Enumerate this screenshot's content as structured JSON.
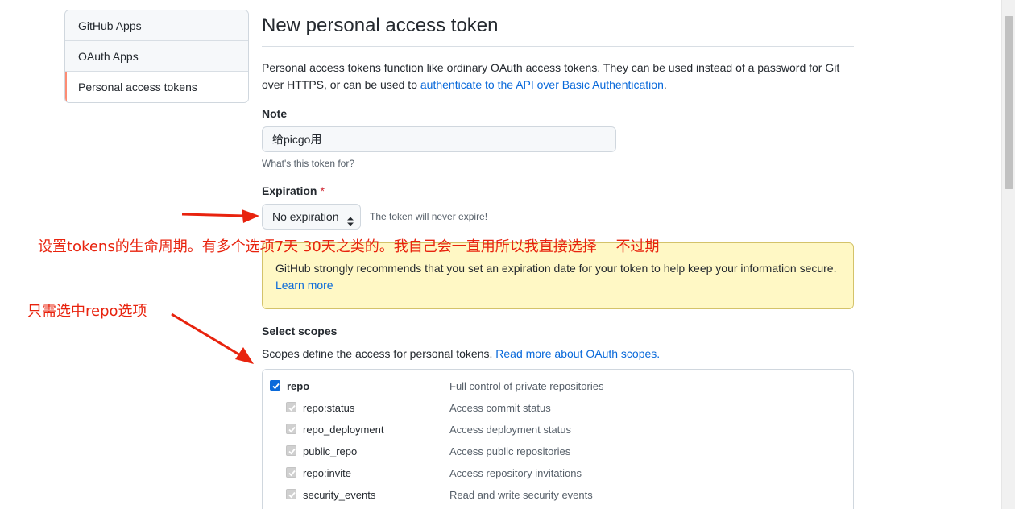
{
  "sidebar": {
    "items": [
      {
        "label": "GitHub Apps"
      },
      {
        "label": "OAuth Apps"
      },
      {
        "label": "Personal access tokens"
      }
    ]
  },
  "page": {
    "title": "New personal access token",
    "intro_text": "Personal access tokens function like ordinary OAuth access tokens. They can be used instead of a password for Git over HTTPS, or can be used to ",
    "intro_link": "authenticate to the API over Basic Authentication",
    "intro_end": "."
  },
  "note": {
    "label": "Note",
    "value": "给picgo用",
    "hint": "What's this token for?"
  },
  "expiration": {
    "label": "Expiration",
    "required_mark": "*",
    "selected": "No expiration",
    "hint": "The token will never expire!"
  },
  "warning": {
    "text": "GitHub strongly recommends that you set an expiration date for your token to help keep your information secure. ",
    "link": "Learn more"
  },
  "scopes": {
    "heading": "Select scopes",
    "desc_text": "Scopes define the access for personal tokens. ",
    "desc_link": "Read more about OAuth scopes.",
    "items": [
      {
        "name": "repo",
        "desc": "Full control of private repositories"
      },
      {
        "name": "repo:status",
        "desc": "Access commit status"
      },
      {
        "name": "repo_deployment",
        "desc": "Access deployment status"
      },
      {
        "name": "public_repo",
        "desc": "Access public repositories"
      },
      {
        "name": "repo:invite",
        "desc": "Access repository invitations"
      },
      {
        "name": "security_events",
        "desc": "Read and write security events"
      }
    ]
  },
  "annotations": {
    "expiration_note": "设置tokens的生命周期。有多个选项7天 30天之类的。我自己会一直用所以我直接选择　 不过期",
    "repo_note": "只需选中repo选项"
  },
  "colors": {
    "accent": "#0969da",
    "annotation": "#e8230e",
    "warning_bg": "#fff8c5",
    "selected_marker": "#fd8c73"
  }
}
